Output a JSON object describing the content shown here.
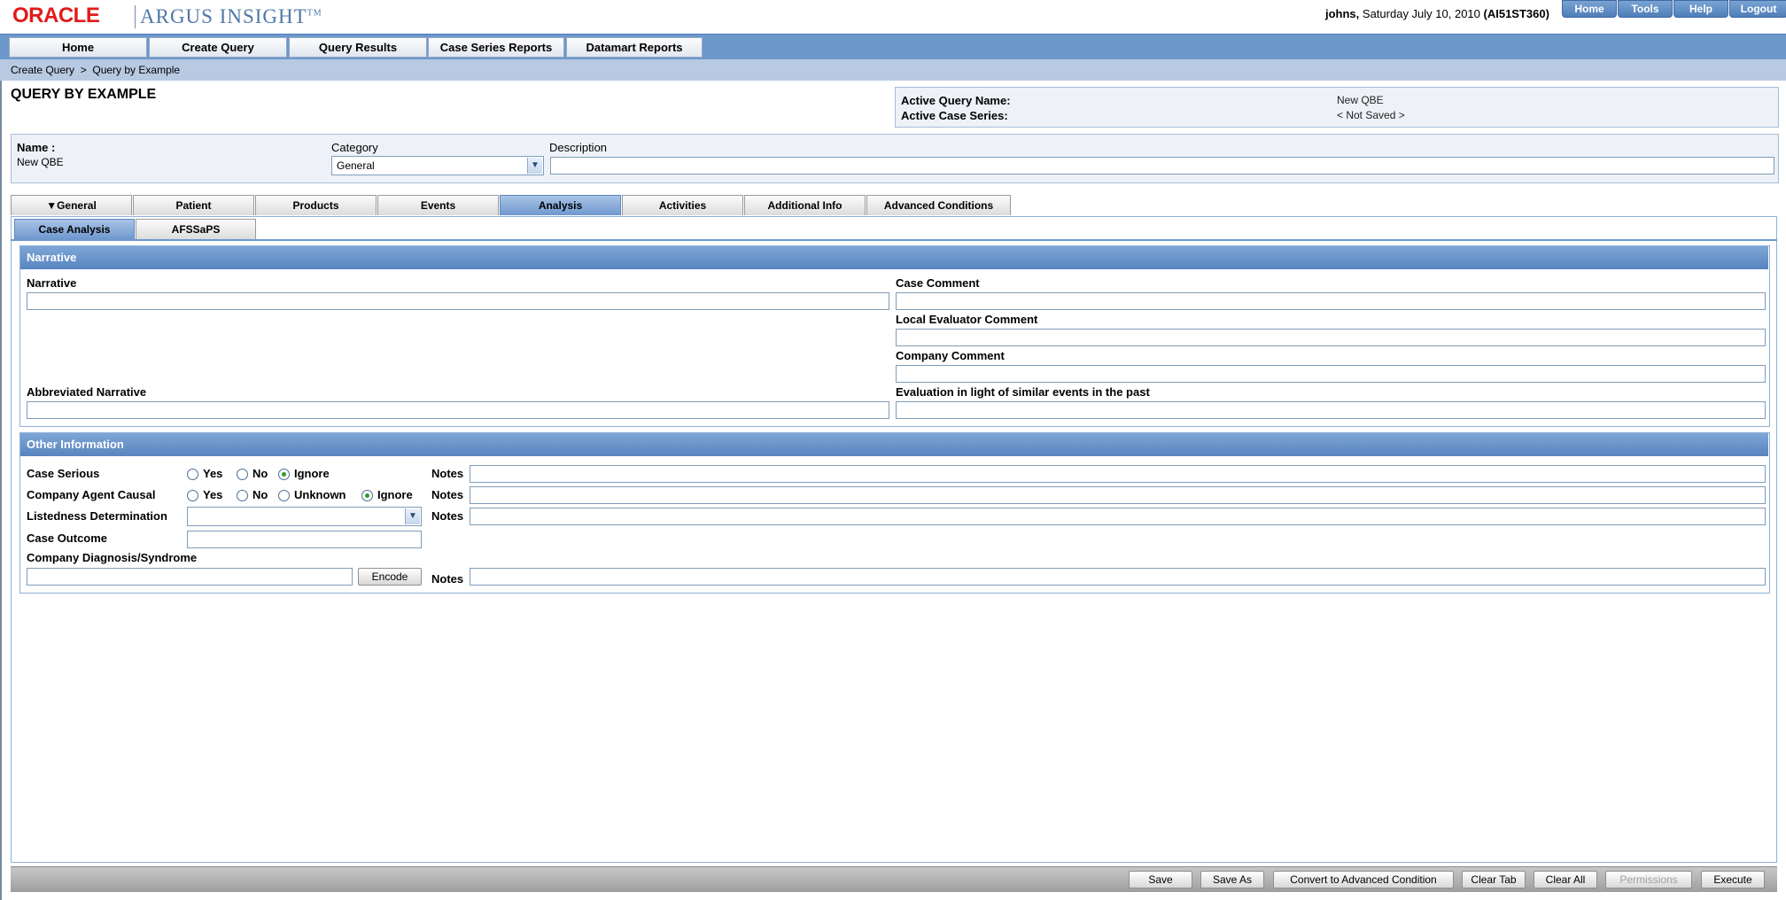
{
  "brand": {
    "oracle": "ORACLE",
    "product": "ARGUS INSIGHT",
    "tm": "TM"
  },
  "user": {
    "name": "johns,",
    "date": "Saturday July 10, 2010",
    "db": "(AI51ST360)"
  },
  "util_nav": [
    "Home",
    "Tools",
    "Help",
    "Logout"
  ],
  "main_nav": [
    "Home",
    "Create Query",
    "Query Results",
    "Case Series Reports",
    "Datamart Reports"
  ],
  "breadcrumb": "Create Query  >  Query by Example",
  "page_title": "QUERY BY EXAMPLE",
  "active_query": {
    "name_label": "Active Query Name:",
    "name_value": "New QBE",
    "series_label": "Active Case Series:",
    "series_value": "< Not Saved >"
  },
  "query_header": {
    "name_label": "Name :",
    "name_value": "New QBE",
    "category_label": "Category",
    "category_value": "General",
    "description_label": "Description",
    "description_value": ""
  },
  "tabs": [
    "General",
    "Patient",
    "Products",
    "Events",
    "Analysis",
    "Activities",
    "Additional Info",
    "Advanced Conditions"
  ],
  "active_tab": "Analysis",
  "subtabs": [
    "Case Analysis",
    "AFSSaPS"
  ],
  "active_subtab": "Case Analysis",
  "narrative_section": {
    "title": "Narrative",
    "narrative_label": "Narrative",
    "abbreviated_label": "Abbreviated Narrative",
    "case_comment_label": "Case Comment",
    "local_eval_label": "Local Evaluator Comment",
    "company_comment_label": "Company Comment",
    "evaluation_label": "Evaluation in light of similar events in the past"
  },
  "other_section": {
    "title": "Other Information",
    "case_serious_label": "Case Serious",
    "company_agent_label": "Company Agent Causal",
    "listedness_label": "Listedness Determination",
    "case_outcome_label": "Case Outcome",
    "diagnosis_label": "Company Diagnosis/Syndrome",
    "notes_label": "Notes",
    "opt_yes": "Yes",
    "opt_no": "No",
    "opt_unknown": "Unknown",
    "opt_ignore": "Ignore",
    "encode_label": "Encode",
    "listedness_value": ""
  },
  "footer_buttons": {
    "save": "Save",
    "save_as": "Save As",
    "convert": "Convert to Advanced Condition",
    "clear_tab": "Clear Tab",
    "clear_all": "Clear All",
    "permissions": "Permissions",
    "execute": "Execute"
  }
}
